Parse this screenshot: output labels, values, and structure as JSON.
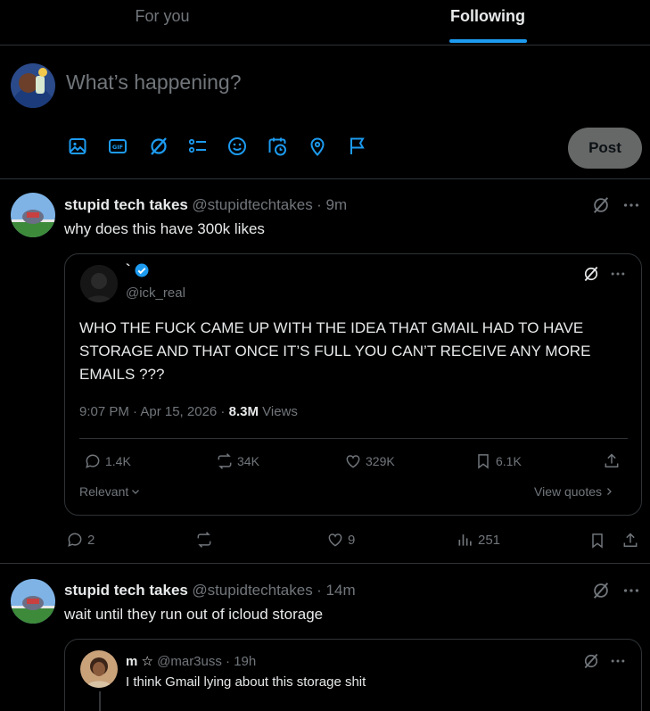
{
  "tabs": [
    {
      "label": "For you",
      "active": false
    },
    {
      "label": "Following",
      "active": true
    }
  ],
  "composer": {
    "placeholder": "What’s happening?",
    "post_label": "Post",
    "toolbar_icons": [
      "image-icon",
      "gif-icon",
      "grok-icon",
      "poll-icon",
      "emoji-icon",
      "schedule-icon",
      "location-icon",
      "flag-icon"
    ]
  },
  "tweets": [
    {
      "name": "stupid tech takes",
      "handle": "@stupidtechtakes",
      "time": "· 9m",
      "text": "why does this have 300k likes",
      "quote": {
        "name": "`",
        "verified": true,
        "handle": "@ick_real",
        "text": "WHO THE FUCK CAME UP WITH THE IDEA THAT GMAIL HAD TO HAVE STORAGE AND THAT ONCE IT’S FULL YOU CAN’T RECEIVE ANY MORE EMAILS ???",
        "meta_time": "9:07 PM · Apr 15, 2026 ·",
        "views_count": "8.3M",
        "views_label": "Views",
        "stats": {
          "replies": "1.4K",
          "reposts": "34K",
          "likes": "329K",
          "bookmarks": "6.1K"
        },
        "relevant_label": "Relevant",
        "view_quotes_label": "View quotes"
      },
      "stats": {
        "replies": "2",
        "reposts": "",
        "likes": "9",
        "views": "251"
      }
    },
    {
      "name": "stupid tech takes",
      "handle": "@stupidtechtakes",
      "time": "· 14m",
      "text": "wait until they run out of icloud storage",
      "quote": {
        "name": "m ☆",
        "handle": "@mar3uss",
        "time": "· 19h",
        "text": "I think Gmail lying about this storage shit"
      }
    }
  ],
  "colors": {
    "accent": "#1d9bf0",
    "background": "#000000",
    "border": "#2f3336",
    "muted": "#71767b",
    "text": "#e7e9ea"
  }
}
